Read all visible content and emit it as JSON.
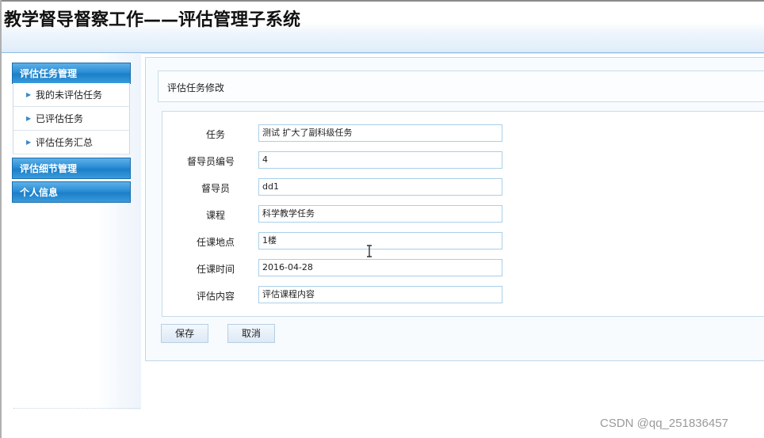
{
  "app_title": "教学督导督察工作——评估管理子系统",
  "sidebar": {
    "sections": [
      {
        "label": "评估任务管理"
      },
      {
        "label": "评估细节管理"
      },
      {
        "label": "个人信息"
      }
    ],
    "items": [
      {
        "label": "我的未评估任务"
      },
      {
        "label": "已评估任务"
      },
      {
        "label": "评估任务汇总"
      }
    ]
  },
  "panel": {
    "title": "评估任务修改"
  },
  "form": {
    "fields": [
      {
        "label": "任务",
        "value": "测试 扩大了副科级任务"
      },
      {
        "label": "督导员编号",
        "value": "4"
      },
      {
        "label": "督导员",
        "value": "dd1"
      },
      {
        "label": "课程",
        "value": "科学教学任务"
      },
      {
        "label": "任课地点",
        "value": "1楼"
      },
      {
        "label": "任课时间",
        "value": "2016-04-28"
      },
      {
        "label": "评估内容",
        "value": "评估课程内容"
      }
    ]
  },
  "buttons": {
    "save": "保存",
    "cancel": "取消"
  },
  "watermark": "CSDN @qq_251836457",
  "colors": {
    "accent": "#1c7fc8",
    "border": "#a9cfe9"
  }
}
